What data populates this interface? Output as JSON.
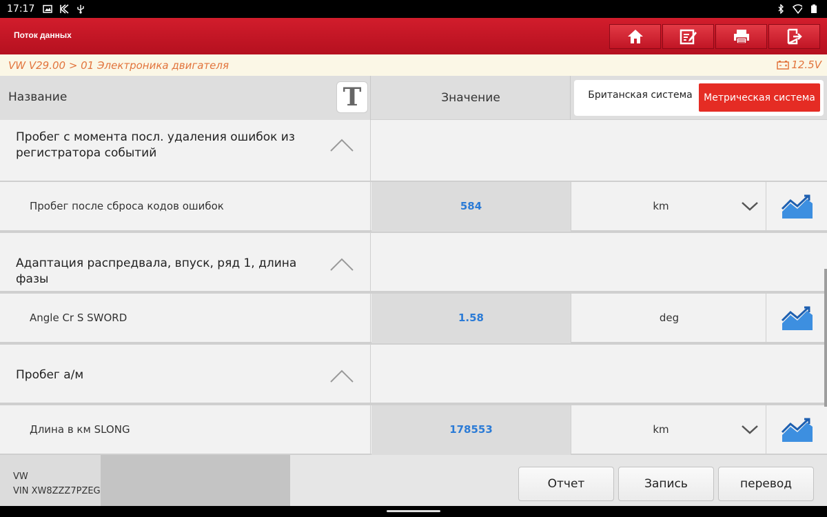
{
  "statusbar": {
    "time": "17:17"
  },
  "appbar": {
    "title": "Поток данных"
  },
  "breadcrumb": {
    "path": "VW V29.00 > 01 Электроника двигателя",
    "voltage": "12.5V"
  },
  "table_header": {
    "name": "Название",
    "value": "Значение",
    "font_button": "T",
    "unit_british": "Британская система",
    "unit_metric": "Метрическая система"
  },
  "groups": [
    {
      "title": "Пробег с момента посл. удаления ошибок из регистратора событий",
      "item": {
        "name": "Пробег после сброса кодов ошибок",
        "value": "584",
        "unit": "km",
        "has_dropdown": true
      }
    },
    {
      "title": "Адаптация распредвала, впуск, ряд 1, длина фазы",
      "item": {
        "name": "Angle Cr S SWORD",
        "value": "1.58",
        "unit": "deg",
        "has_dropdown": false
      }
    },
    {
      "title": "Пробег а/м",
      "item": {
        "name": "Длина в км SLONG",
        "value": "178553",
        "unit": "km",
        "has_dropdown": true
      }
    }
  ],
  "footer": {
    "make": "VW",
    "vin": "VIN XW8ZZZ7PZEG",
    "btn_report": "Отчет",
    "btn_record": "Запись",
    "btn_translate": "перевод"
  },
  "colors": {
    "accent_red": "#d21d2c",
    "value_blue": "#2b7bd6",
    "metric_active": "#e52c24",
    "crumb_orange": "#e2743c"
  }
}
